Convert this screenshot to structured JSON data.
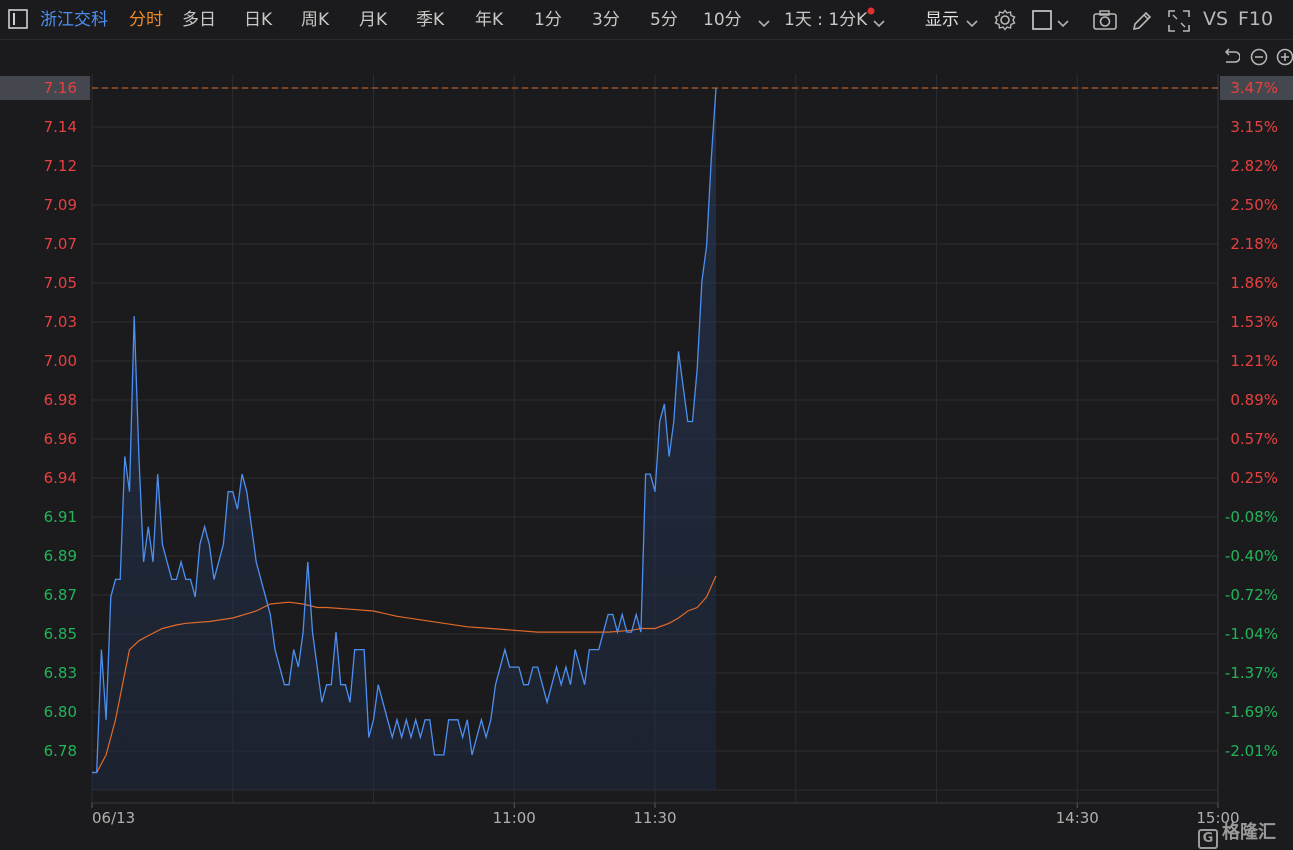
{
  "toolbar": {
    "stock_name": "浙江交科",
    "tabs": [
      "分时",
      "多日",
      "日K",
      "周K",
      "月K",
      "季K",
      "年K",
      "1分",
      "3分",
      "5分",
      "10分"
    ],
    "active_tab": "分时",
    "period_select": "1天 : 1分K",
    "display_menu": "显示",
    "vs_label": "VS",
    "f10_label": "F10"
  },
  "watermark": {
    "text": "格隆汇",
    "logo_letter": "G"
  },
  "colors": {
    "background": "#1b1b1d",
    "price_line": "#4d8ff0",
    "avg_line": "#e06a2a",
    "up": "#e84040",
    "down": "#22b45a",
    "grid": "#2c2c30",
    "active_tab": "#f08a24",
    "stock_name": "#4d8ff0"
  },
  "chart_data": {
    "type": "line",
    "current_price_label": "7.16",
    "current_pct_label": "3.47%",
    "y_tick_labels": [
      "7.16",
      "7.14",
      "7.12",
      "7.09",
      "7.07",
      "7.05",
      "7.03",
      "7.00",
      "6.98",
      "6.96",
      "6.94",
      "6.91",
      "6.89",
      "6.87",
      "6.85",
      "6.83",
      "6.80",
      "6.78"
    ],
    "y_tick_colors": [
      "up",
      "up",
      "up",
      "up",
      "up",
      "up",
      "up",
      "up",
      "up",
      "up",
      "up",
      "down",
      "down",
      "down",
      "down",
      "down",
      "down",
      "down"
    ],
    "pct_tick_labels": [
      "3.15%",
      "2.82%",
      "2.50%",
      "2.18%",
      "1.86%",
      "1.53%",
      "1.21%",
      "0.89%",
      "0.57%",
      "0.25%",
      "-0.08%",
      "-0.40%",
      "-0.72%",
      "-1.04%",
      "-1.37%",
      "-1.69%",
      "-2.01%"
    ],
    "x_tick_labels": [
      "06/13",
      "11:00",
      "11:30",
      "14:30",
      "15:00"
    ],
    "ylim": [
      6.76,
      7.16
    ],
    "total_minutes": 240,
    "x_tick_minutes": [
      0,
      90,
      120,
      210,
      240
    ],
    "price_series": {
      "minutes": [
        0,
        1,
        2,
        3,
        4,
        5,
        6,
        7,
        8,
        9,
        10,
        11,
        12,
        13,
        14,
        15,
        16,
        17,
        18,
        19,
        20,
        21,
        22,
        23,
        24,
        25,
        26,
        27,
        28,
        29,
        30,
        31,
        32,
        33,
        34,
        35,
        36,
        37,
        38,
        39,
        40,
        41,
        42,
        43,
        44,
        45,
        46,
        47,
        48,
        49,
        50,
        51,
        52,
        53,
        54,
        55,
        56,
        57,
        58,
        59,
        60,
        61,
        62,
        63,
        64,
        65,
        66,
        67,
        68,
        69,
        70,
        71,
        72,
        73,
        74,
        75,
        76,
        77,
        78,
        79,
        80,
        81,
        82,
        83,
        84,
        85,
        86,
        87,
        88,
        89,
        90,
        91,
        92,
        93,
        94,
        95,
        96,
        97,
        98,
        99,
        100,
        101,
        102,
        103,
        104,
        105,
        106,
        107,
        108,
        109,
        110,
        111,
        112,
        113,
        114,
        115,
        116,
        117,
        118,
        119,
        120,
        121,
        122,
        123,
        124,
        125,
        126,
        127,
        128,
        129,
        130,
        131,
        132,
        133
      ],
      "values": [
        6.77,
        6.77,
        6.84,
        6.8,
        6.87,
        6.88,
        6.88,
        6.95,
        6.93,
        7.03,
        6.95,
        6.89,
        6.91,
        6.89,
        6.94,
        6.9,
        6.89,
        6.88,
        6.88,
        6.89,
        6.88,
        6.88,
        6.87,
        6.9,
        6.91,
        6.9,
        6.88,
        6.89,
        6.9,
        6.93,
        6.93,
        6.92,
        6.94,
        6.93,
        6.91,
        6.89,
        6.88,
        6.87,
        6.86,
        6.84,
        6.83,
        6.82,
        6.82,
        6.84,
        6.83,
        6.85,
        6.89,
        6.85,
        6.83,
        6.81,
        6.82,
        6.82,
        6.85,
        6.82,
        6.82,
        6.81,
        6.84,
        6.84,
        6.84,
        6.79,
        6.8,
        6.82,
        6.81,
        6.8,
        6.79,
        6.8,
        6.79,
        6.8,
        6.79,
        6.8,
        6.79,
        6.8,
        6.8,
        6.78,
        6.78,
        6.78,
        6.8,
        6.8,
        6.8,
        6.79,
        6.8,
        6.78,
        6.79,
        6.8,
        6.79,
        6.8,
        6.82,
        6.83,
        6.84,
        6.83,
        6.83,
        6.83,
        6.82,
        6.82,
        6.83,
        6.83,
        6.82,
        6.81,
        6.82,
        6.83,
        6.82,
        6.83,
        6.82,
        6.84,
        6.83,
        6.82,
        6.84,
        6.84,
        6.84,
        6.85,
        6.86,
        6.86,
        6.85,
        6.86,
        6.85,
        6.85,
        6.86,
        6.85,
        6.94,
        6.94,
        6.93,
        6.97,
        6.98,
        6.95,
        6.97,
        7.01,
        6.99,
        6.97,
        6.97,
        7.0,
        7.05,
        7.07,
        7.12,
        7.16
      ]
    },
    "avg_series": {
      "minutes": [
        0,
        1,
        3,
        5,
        8,
        10,
        12,
        15,
        18,
        20,
        25,
        30,
        35,
        38,
        42,
        45,
        48,
        50,
        55,
        60,
        65,
        70,
        75,
        80,
        85,
        90,
        95,
        100,
        105,
        110,
        115,
        117,
        120,
        123,
        125,
        127,
        129,
        131,
        133
      ],
      "values": [
        6.77,
        6.77,
        6.78,
        6.8,
        6.84,
        6.845,
        6.848,
        6.852,
        6.854,
        6.855,
        6.856,
        6.858,
        6.862,
        6.866,
        6.867,
        6.866,
        6.864,
        6.864,
        6.863,
        6.862,
        6.859,
        6.857,
        6.855,
        6.853,
        6.852,
        6.851,
        6.85,
        6.85,
        6.85,
        6.85,
        6.851,
        6.852,
        6.852,
        6.855,
        6.858,
        6.862,
        6.864,
        6.87,
        6.882
      ]
    }
  }
}
